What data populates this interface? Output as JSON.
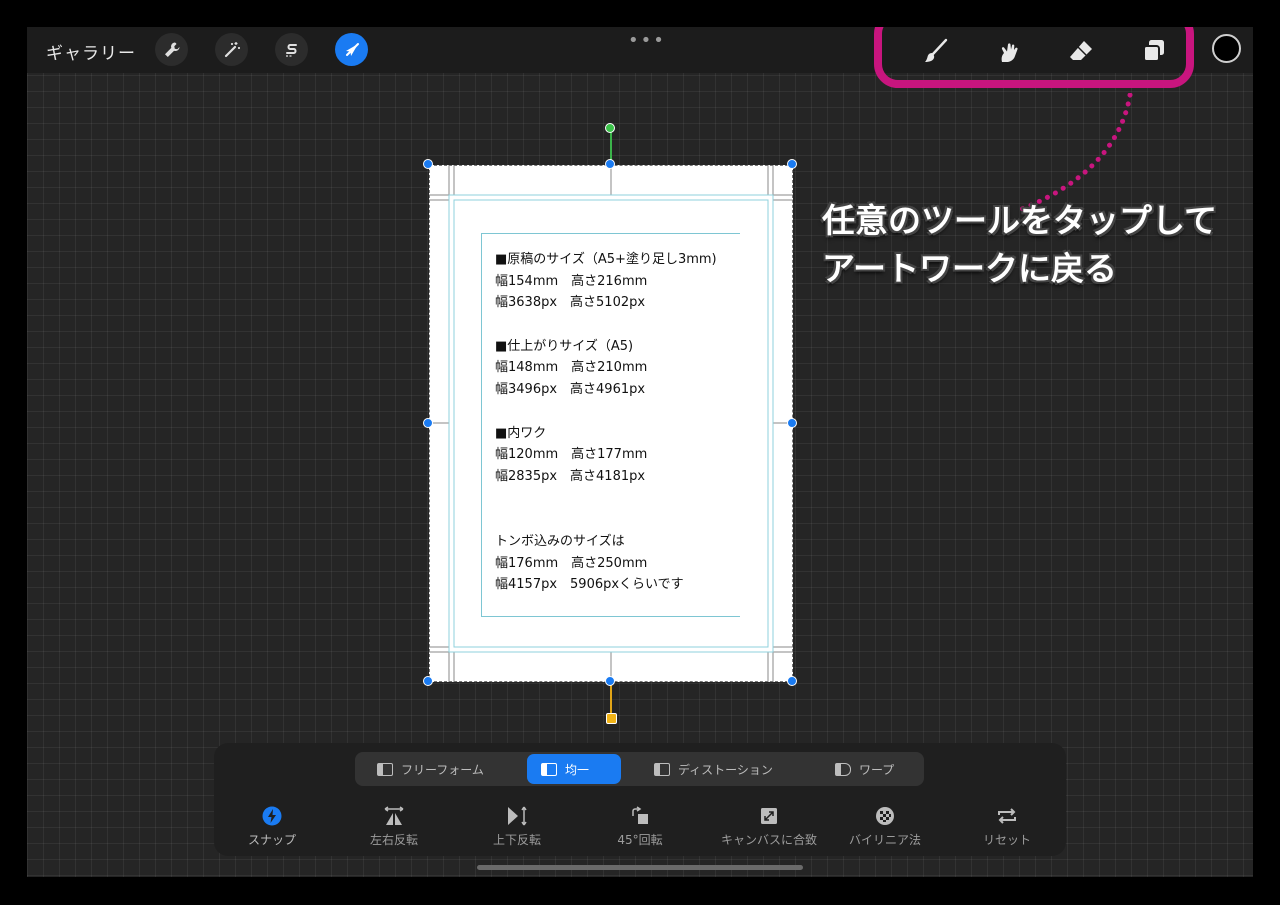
{
  "topbar": {
    "gallery_label": "ギャラリー",
    "more_label": "•••"
  },
  "left_tools": [
    {
      "name": "actions",
      "icon": "wrench-icon",
      "active": false
    },
    {
      "name": "adjustments",
      "icon": "magic-wand-icon",
      "active": false
    },
    {
      "name": "selection",
      "icon": "selection-s-icon",
      "active": false
    },
    {
      "name": "transform",
      "icon": "arrow-cursor-icon",
      "active": true
    }
  ],
  "right_tools": [
    {
      "name": "brush",
      "icon": "brush-icon"
    },
    {
      "name": "smudge",
      "icon": "smudge-finger-icon"
    },
    {
      "name": "eraser",
      "icon": "eraser-icon"
    },
    {
      "name": "layers",
      "icon": "layers-icon"
    }
  ],
  "color": {
    "current": "#000000"
  },
  "accent": "#1a7bf2",
  "annotation": {
    "color": "#c8157e",
    "line1": "任意のツールをタップして",
    "line2": "アートワークに戻る"
  },
  "canvas_text": {
    "lines": [
      "■原稿のサイズ（A5+塗り足し3mm)",
      "幅154mm　高さ216mm",
      "幅3638px　高さ5102px",
      "",
      "■仕上がりサイズ（A5)",
      "幅148mm　高さ210mm",
      "幅3496px　高さ4961px",
      "",
      "■内ワク",
      "幅120mm　高さ177mm",
      "幅2835px　高さ4181px",
      "",
      "",
      "トンボ込みのサイズは",
      "幅176mm　高さ250mm",
      "幅4157px　5906pxくらいです"
    ]
  },
  "modes": [
    {
      "label": "フリーフォーム",
      "active": false
    },
    {
      "label": "均一",
      "active": true
    },
    {
      "label": "ディストーション",
      "active": false
    },
    {
      "label": "ワープ",
      "active": false
    }
  ],
  "actions": [
    {
      "label": "スナップ",
      "icon": "snap-lightning-icon",
      "active": true
    },
    {
      "label": "左右反転",
      "icon": "flip-horizontal-icon",
      "active": false
    },
    {
      "label": "上下反転",
      "icon": "flip-vertical-icon",
      "active": false
    },
    {
      "label": "45°回転",
      "icon": "rotate-45-icon",
      "active": false
    },
    {
      "label": "キャンバスに合致",
      "icon": "fit-to-canvas-icon",
      "active": false
    },
    {
      "label": "バイリニア法",
      "icon": "bilinear-icon",
      "active": false
    },
    {
      "label": "リセット",
      "icon": "reset-icon",
      "active": false
    }
  ]
}
